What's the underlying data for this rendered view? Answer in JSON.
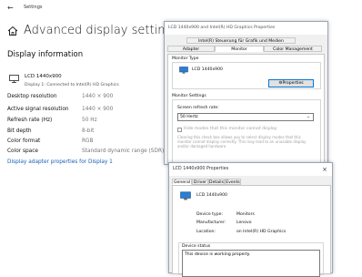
{
  "settings": {
    "window_title": "Settings",
    "page_title": "Advanced display settings",
    "section_title": "Display information",
    "monitor": {
      "name": "LCD 1440x900",
      "subtitle": "Display 1: Connected to Intel(R) HD Graphics"
    },
    "rows": [
      {
        "label": "Desktop resolution",
        "value": "1440 × 900"
      },
      {
        "label": "Active signal resolution",
        "value": "1440 × 900"
      },
      {
        "label": "Refresh rate (Hz)",
        "value": "50 Hz"
      },
      {
        "label": "Bit depth",
        "value": "8-bit"
      },
      {
        "label": "Color format",
        "value": "RGB"
      },
      {
        "label": "Color space",
        "value": "Standard dynamic range (SDR)"
      }
    ],
    "adapter_link": "Display adapter properties for Display 1"
  },
  "properties_dialog": {
    "title": "LCD 1440x900 and Intel(R) HD Graphics Properties",
    "tabs_top": [
      "Intel(R) Steuerung für Grafik und Medien"
    ],
    "tabs_bottom": [
      "Adapter",
      "Monitor",
      "Color Management"
    ],
    "active_tab": "Monitor",
    "monitor_type_label": "Monitor Type",
    "monitor_type_value": "LCD 1440x900",
    "properties_button": "Properties",
    "monitor_settings_label": "Monitor Settings",
    "refresh_label": "Screen refresh rate:",
    "refresh_value": "50 Hertz",
    "hide_modes_label": "Hide modes that this monitor cannot display",
    "hide_modes_help": "Clearing this check box allows you to select display modes that this monitor cannot display correctly. This may lead to an unusable display and/or damaged hardware."
  },
  "monitor_dialog": {
    "title": "LCD 1440x900 Properties",
    "tabs": [
      "General",
      "Driver",
      "Details",
      "Events"
    ],
    "active_tab": "General",
    "device_name": "LCD 1440x900",
    "fields": [
      {
        "label": "Device type:",
        "value": "Monitors"
      },
      {
        "label": "Manufacturer:",
        "value": "Lenovo"
      },
      {
        "label": "Location:",
        "value": "on Intel(R) HD Graphics"
      }
    ],
    "status_label": "Device status",
    "status_text": "This device is working properly."
  },
  "colors": {
    "accent": "#1a5fb4",
    "focus": "#0078d7",
    "monitor_blue": "#2a7fd4"
  }
}
